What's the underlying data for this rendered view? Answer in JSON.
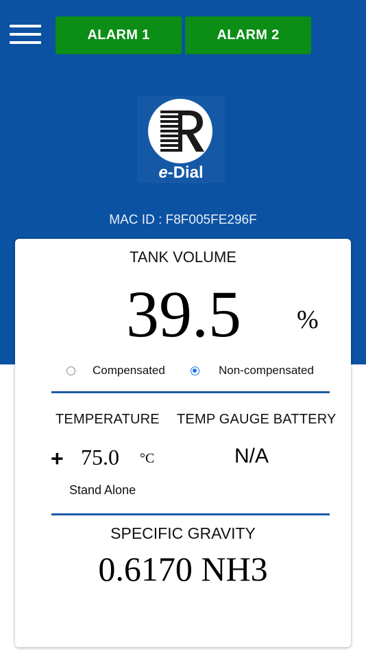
{
  "header": {
    "menu_icon": "hamburger-menu-icon",
    "alarm1_label": "ALARM 1",
    "alarm2_label": "ALARM 2",
    "colors": {
      "background": "#0b52a3",
      "alarm_button": "#0b8d16"
    }
  },
  "logo": {
    "brand_letter": "R",
    "name_prefix": "e",
    "name_suffix": "-Dial"
  },
  "device": {
    "mac_label": "MAC ID : F8F005FE296F"
  },
  "tank_volume": {
    "title": "TANK VOLUME",
    "value": "39.5",
    "unit": "%",
    "options": [
      {
        "label": "Compensated",
        "selected": false
      },
      {
        "label": "Non-compensated",
        "selected": true
      }
    ]
  },
  "temperature": {
    "title": "TEMPERATURE",
    "sign": "+",
    "value": "75.0",
    "unit": "°C",
    "mode": "Stand Alone"
  },
  "temp_gauge_battery": {
    "title": "TEMP GAUGE BATTERY",
    "value": "N/A"
  },
  "specific_gravity": {
    "title": "SPECIFIC GRAVITY",
    "value": "0.6170 NH3"
  },
  "accent_color": "#1b5aa6",
  "radio_color": "#1a73e8"
}
